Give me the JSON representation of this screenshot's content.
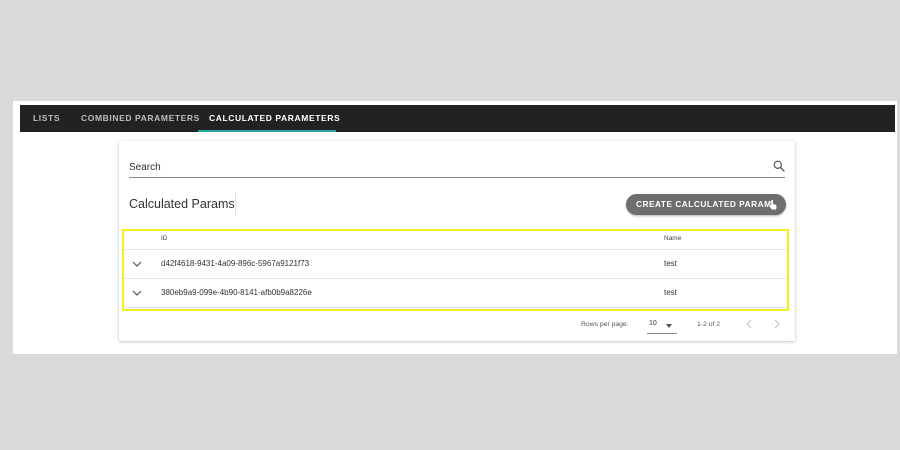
{
  "tabs": [
    {
      "label": "LISTS",
      "active": false
    },
    {
      "label": "COMBINED PARAMETERS",
      "active": false
    },
    {
      "label": "CALCULATED PARAMETERS",
      "active": true
    }
  ],
  "search": {
    "placeholder": "Search",
    "value": "",
    "icon": "search-icon"
  },
  "section": {
    "title": "Calculated Params"
  },
  "create_button": {
    "label": "CREATE CALCULATED PARAM",
    "icon": "touch-hand-icon"
  },
  "table": {
    "columns": [
      "ID",
      "Name"
    ],
    "rows": [
      {
        "id": "d42f4618-9431-4a09-896c-5967a9121f73",
        "name": "test"
      },
      {
        "id": "380eb9a9-099e-4b90-8141-afb0b9a8226e",
        "name": "test"
      }
    ]
  },
  "pagination": {
    "rows_per_page_label": "Rows per page:",
    "rows_per_page_value": "10",
    "range": "1-2 of 2"
  },
  "colors": {
    "tab_bar": "#222222",
    "active_tab_underline": "#26a69a",
    "button": "#6e6e6e",
    "highlight": "#f5ef21"
  }
}
